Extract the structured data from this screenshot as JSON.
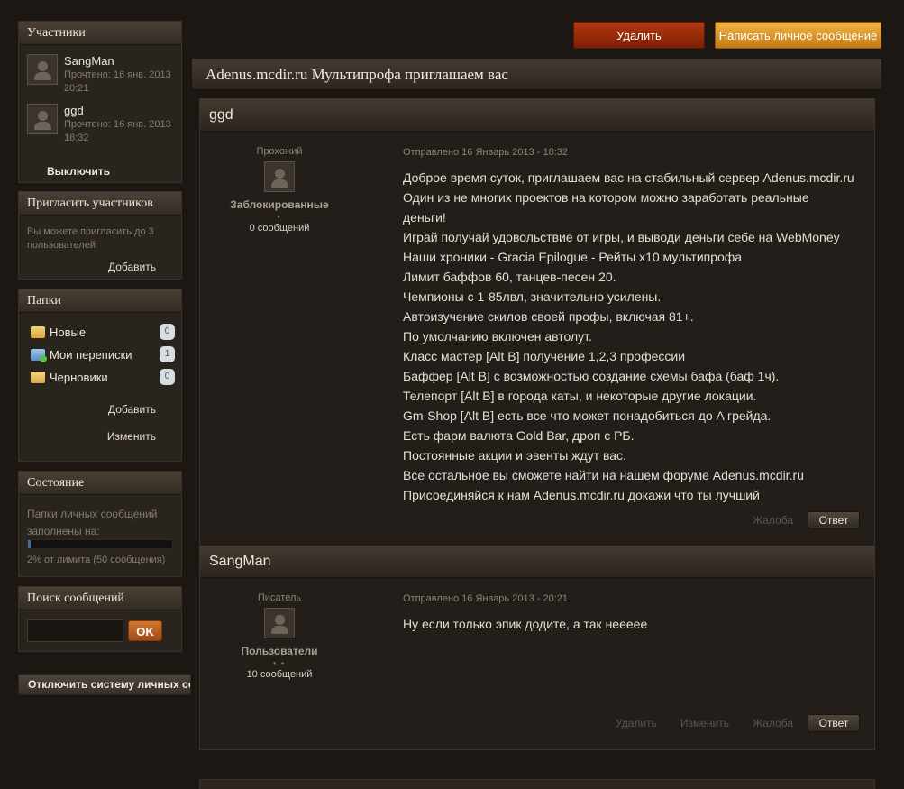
{
  "sidebar": {
    "participants": {
      "title": "Участники",
      "items": [
        {
          "name": "SangMan",
          "read": "Прочтено: 16 янв. 2013 20:21"
        },
        {
          "name": "ggd",
          "read": "Прочтено: 16 янв. 2013 18:32"
        }
      ],
      "notify_link": "Выключить уведомления"
    },
    "invite": {
      "title": "Пригласить участников",
      "note": "Вы можете пригласить до 3 пользователей",
      "add": "Добавить"
    },
    "folders": {
      "title": "Папки",
      "items": [
        {
          "label": "Новые",
          "count": "0"
        },
        {
          "label": "Мои переписки",
          "count": "1"
        },
        {
          "label": "Черновики",
          "count": "0"
        }
      ],
      "add": "Добавить",
      "edit": "Изменить"
    },
    "status": {
      "title": "Состояние",
      "text": "Папки личных сообщений заполнены на:",
      "fill_percent": 2,
      "limit": "2% от лимита (50 сообщения)"
    },
    "search": {
      "title": "Поиск сообщений",
      "value": "",
      "button": "OK"
    },
    "disable_button": "Отключить систему личных сообщений"
  },
  "toolbar": {
    "delete": "Удалить",
    "write": "Написать личное сообщение"
  },
  "topic": {
    "title": "Adenus.mcdir.ru Мультипрофа приглашаем вас"
  },
  "posts": [
    {
      "author": "ggd",
      "rank": "Прохожий",
      "group": "Заблокированные",
      "dots": "•",
      "count": "0 сообщений",
      "date": "Отправлено 16 Январь 2013 - 18:32",
      "lines": [
        "Доброе время суток, приглашаем вас на стабильный сервер Adenus.mcdir.ru",
        "Один из не многих проектов на котором можно заработать реальные",
        "деньги!",
        "Играй получай удовольствие от игры, и выводи деньги себе на WebMoney",
        "Наши хроники - Gracia Epilogue - Рейты x10 мультипрофа",
        "Лимит баффов 60, танцев-песен 20.",
        "Чемпионы с 1-85лвл, значительно усилены.",
        "Автоизучение скилов своей профы, включая 81+.",
        "По умолчанию включен автолут.",
        "Класс мастер [Alt B] получение 1,2,3 профессии",
        "Баффер [Alt B] с возможностью создание схемы бафа (баф 1ч).",
        "Телепорт [Alt B] в города каты, и некоторые другие локации.",
        "Gm-Shop [Alt B] есть все что может понадобиться до A грейда.",
        "Есть фарм валюта Gold Bar, дроп с РБ.",
        "Постоянные акции и эвенты ждут вас.",
        "Все остальное вы сможете найти на нашем форуме Adenus.mcdir.ru",
        "Присоединяйся к нам Adenus.mcdir.ru докажи что ты лучший"
      ],
      "report": "Жалоба",
      "reply": "Ответ"
    },
    {
      "author": "SangMan",
      "rank": "Писатель",
      "group": "Пользователи",
      "dots": "• •",
      "count": "10 сообщений",
      "date": "Отправлено 16 Январь 2013 - 20:21",
      "lines": [
        "Ну если только эпик додите, а так неееее"
      ],
      "delete": "Удалить",
      "edit": "Изменить",
      "report": "Жалоба",
      "reply": "Ответ"
    }
  ]
}
